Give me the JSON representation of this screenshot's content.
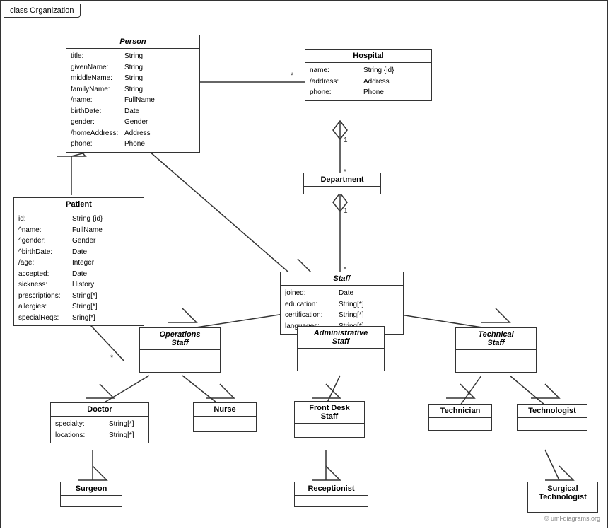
{
  "title": "class Organization",
  "classes": {
    "person": {
      "name": "Person",
      "italic": true,
      "attrs": [
        {
          "name": "title:",
          "type": "String"
        },
        {
          "name": "givenName:",
          "type": "String"
        },
        {
          "name": "middleName:",
          "type": "String"
        },
        {
          "name": "familyName:",
          "type": "String"
        },
        {
          "name": "/name:",
          "type": "FullName"
        },
        {
          "name": "birthDate:",
          "type": "Date"
        },
        {
          "name": "gender:",
          "type": "Gender"
        },
        {
          "name": "/homeAddress:",
          "type": "Address"
        },
        {
          "name": "phone:",
          "type": "Phone"
        }
      ]
    },
    "hospital": {
      "name": "Hospital",
      "italic": false,
      "attrs": [
        {
          "name": "name:",
          "type": "String {id}"
        },
        {
          "name": "/address:",
          "type": "Address"
        },
        {
          "name": "phone:",
          "type": "Phone"
        }
      ]
    },
    "patient": {
      "name": "Patient",
      "italic": false,
      "attrs": [
        {
          "name": "id:",
          "type": "String {id}"
        },
        {
          "name": "^name:",
          "type": "FullName"
        },
        {
          "name": "^gender:",
          "type": "Gender"
        },
        {
          "name": "^birthDate:",
          "type": "Date"
        },
        {
          "name": "/age:",
          "type": "Integer"
        },
        {
          "name": "accepted:",
          "type": "Date"
        },
        {
          "name": "sickness:",
          "type": "History"
        },
        {
          "name": "prescriptions:",
          "type": "String[*]"
        },
        {
          "name": "allergies:",
          "type": "String[*]"
        },
        {
          "name": "specialReqs:",
          "type": "Sring[*]"
        }
      ]
    },
    "department": {
      "name": "Department",
      "italic": false,
      "attrs": []
    },
    "staff": {
      "name": "Staff",
      "italic": true,
      "attrs": [
        {
          "name": "joined:",
          "type": "Date"
        },
        {
          "name": "education:",
          "type": "String[*]"
        },
        {
          "name": "certification:",
          "type": "String[*]"
        },
        {
          "name": "languages:",
          "type": "String[*]"
        }
      ]
    },
    "operationsStaff": {
      "name": "Operations\nStaff",
      "italic": true,
      "attrs": []
    },
    "administrativeStaff": {
      "name": "Administrative\nStaff",
      "italic": true,
      "attrs": []
    },
    "technicalStaff": {
      "name": "Technical\nStaff",
      "italic": true,
      "attrs": []
    },
    "doctor": {
      "name": "Doctor",
      "italic": false,
      "attrs": [
        {
          "name": "specialty:",
          "type": "String[*]"
        },
        {
          "name": "locations:",
          "type": "String[*]"
        }
      ]
    },
    "nurse": {
      "name": "Nurse",
      "italic": false,
      "attrs": []
    },
    "frontDeskStaff": {
      "name": "Front Desk\nStaff",
      "italic": false,
      "attrs": []
    },
    "technician": {
      "name": "Technician",
      "italic": false,
      "attrs": []
    },
    "technologist": {
      "name": "Technologist",
      "italic": false,
      "attrs": []
    },
    "surgeon": {
      "name": "Surgeon",
      "italic": false,
      "attrs": []
    },
    "receptionist": {
      "name": "Receptionist",
      "italic": false,
      "attrs": []
    },
    "surgicalTechnologist": {
      "name": "Surgical\nTechnologist",
      "italic": false,
      "attrs": []
    }
  },
  "watermark": "© uml-diagrams.org"
}
